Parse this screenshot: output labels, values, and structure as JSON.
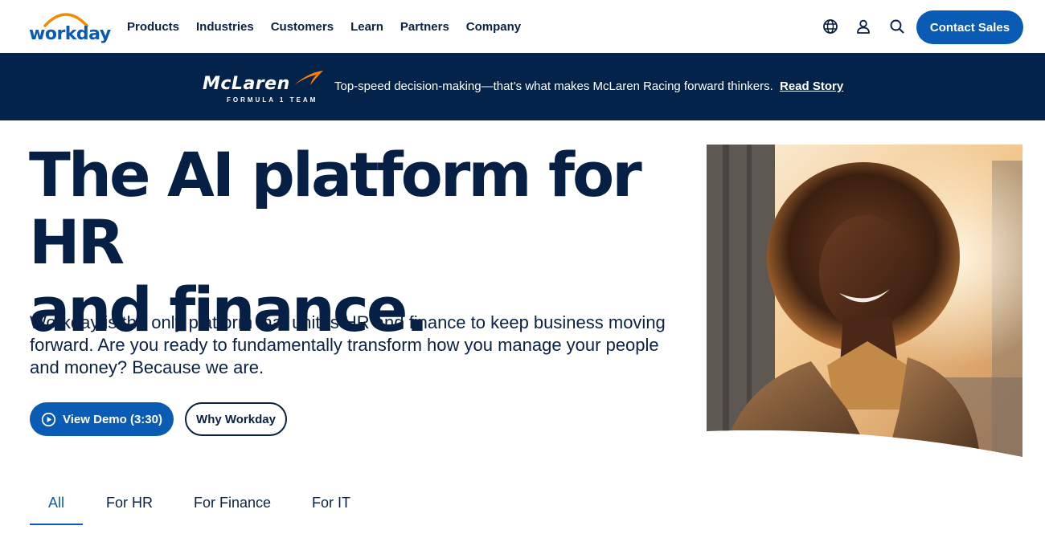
{
  "header": {
    "logo_text": "workday",
    "nav": [
      "Products",
      "Industries",
      "Customers",
      "Learn",
      "Partners",
      "Company"
    ],
    "icons": [
      "globe-icon",
      "user-icon",
      "search-icon"
    ],
    "contact_label": "Contact Sales"
  },
  "banner": {
    "brand_name": "McLaren",
    "brand_sub": "FORMULA 1 TEAM",
    "text": "Top-speed decision-making—that’s what makes McLaren Racing forward thinkers.",
    "link_label": "Read Story"
  },
  "hero": {
    "title_line1": "The AI platform for HR",
    "title_line2": "and finance.",
    "description": "Workday is the only platform that unites HR and finance to keep business moving forward. Are you ready to fundamentally transform how you manage your people and money? Because we are.",
    "primary_label": "View Demo (3:30)",
    "secondary_label": "Why Workday"
  },
  "tabs": {
    "items": [
      "All",
      "For HR",
      "For Finance",
      "For IT"
    ],
    "active_index": 0
  },
  "colors": {
    "brand_blue": "#0a5bb3",
    "navy": "#03234a",
    "logo_orange": "#f38b00"
  }
}
